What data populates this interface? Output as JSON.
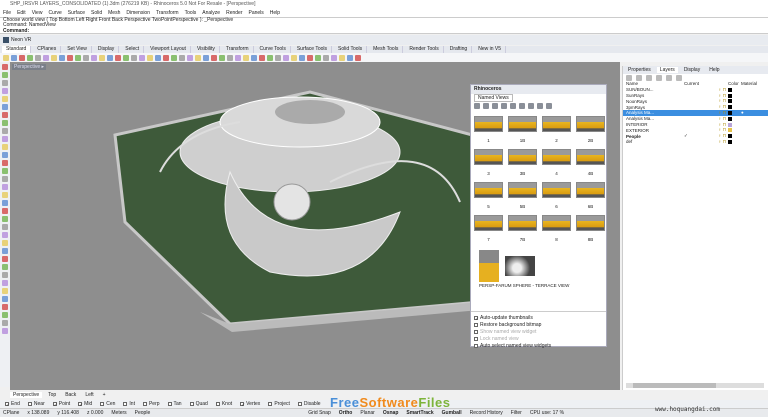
{
  "title": "SHP_IRSVR LAYERS_CONSOLIDATED (1).3dm (276219 KB) - Rhinoceros 5.0 Not For Resale - [Perspective]",
  "menu": [
    "File",
    "Edit",
    "View",
    "Curve",
    "Surface",
    "Solid",
    "Mesh",
    "Dimension",
    "Transform",
    "Tools",
    "Analyze",
    "Render",
    "Panels",
    "Help"
  ],
  "command": {
    "history1": "Choose world view ( Top  Bottom  Left  Right  Front  Back  Perspective  TwoPointPerspective ): _Perspective",
    "history2": "Command: NamedView",
    "prompt": "Command:"
  },
  "neon": "Neon VR",
  "toolbar_tabs": [
    "Standard",
    "CPlanes",
    "Set View",
    "Display",
    "Select",
    "Viewport Layout",
    "Visibility",
    "Transform",
    "Curve Tools",
    "Surface Tools",
    "Solid Tools",
    "Mesh Tools",
    "Render Tools",
    "Drafting",
    "New in V5"
  ],
  "viewport": {
    "label": "Perspective ▸",
    "tabs": [
      "Perspective",
      "Top",
      "Back",
      "Left",
      "+"
    ]
  },
  "dialog": {
    "title": "Rhinoceros",
    "tab": "Named Views",
    "thumbs": [
      "1",
      "1B",
      "2",
      "2B",
      "3",
      "3B",
      "4",
      "4B",
      "5",
      "5B",
      "6",
      "6B",
      "7",
      "7B",
      "8",
      "8B"
    ],
    "special_label": "PERSP-FARUM SPHERE - TERRACE VIEW",
    "options": [
      {
        "label": "Auto-update thumbnails",
        "checked": true
      },
      {
        "label": "Restore background bitmap",
        "checked": false
      },
      {
        "label": "Show named view widget",
        "checked": false,
        "disabled": true
      },
      {
        "label": "Lock named view",
        "checked": false,
        "disabled": true
      },
      {
        "label": "Auto select named view widgets",
        "checked": false
      }
    ]
  },
  "panel": {
    "tabs": [
      "Properties",
      "Layers",
      "Display",
      "Help"
    ],
    "active_tab": "Layers",
    "headers": [
      "Name",
      "Current",
      "",
      "Color",
      "Material"
    ],
    "layers": [
      {
        "name": "SUN/BOUN...",
        "color": "#000000"
      },
      {
        "name": "SunRays",
        "color": "#000000"
      },
      {
        "name": "NoonRays",
        "color": "#000000"
      },
      {
        "name": "3pmRays",
        "color": "#000000"
      },
      {
        "name": "Analysis Ma...",
        "color": "#000000",
        "selected": true
      },
      {
        "name": "Analysis Ma...",
        "color": "#000000"
      },
      {
        "name": "INTERIOR",
        "color": "#b9a6d8"
      },
      {
        "name": "EXTERIOR",
        "color": "#e6c24a"
      },
      {
        "name": "People",
        "color": "#000000",
        "current": true,
        "bold": true
      },
      {
        "name": "def",
        "color": "#000000"
      }
    ]
  },
  "osnap": [
    {
      "label": "End",
      "checked": true
    },
    {
      "label": "Near",
      "checked": false
    },
    {
      "label": "Point",
      "checked": true
    },
    {
      "label": "Mid",
      "checked": true
    },
    {
      "label": "Cen",
      "checked": false
    },
    {
      "label": "Int",
      "checked": false
    },
    {
      "label": "Perp",
      "checked": false
    },
    {
      "label": "Tan",
      "checked": false
    },
    {
      "label": "Quad",
      "checked": false
    },
    {
      "label": "Knot",
      "checked": false
    },
    {
      "label": "Vertex",
      "checked": true
    },
    {
      "label": "Project",
      "checked": false
    },
    {
      "label": "Disable",
      "checked": false
    }
  ],
  "status": [
    "CPlane",
    "x 138.089",
    "y 116.408",
    "z 0.000",
    "Meters",
    "People",
    "Grid Snap",
    "Ortho",
    "Planar",
    "Osnap",
    "SmartTrack",
    "Gumball",
    "Record History",
    "Filter",
    "CPU use: 17 %"
  ],
  "watermark": {
    "part1": "Free",
    "part2": "Software",
    "part3": "Files",
    ".com": ".com",
    "site": "www.hoquangdai.com"
  },
  "colors": {
    "accent": "#3b8ee0",
    "platform": "#3e5a3a",
    "model": "#d8d8d8"
  }
}
